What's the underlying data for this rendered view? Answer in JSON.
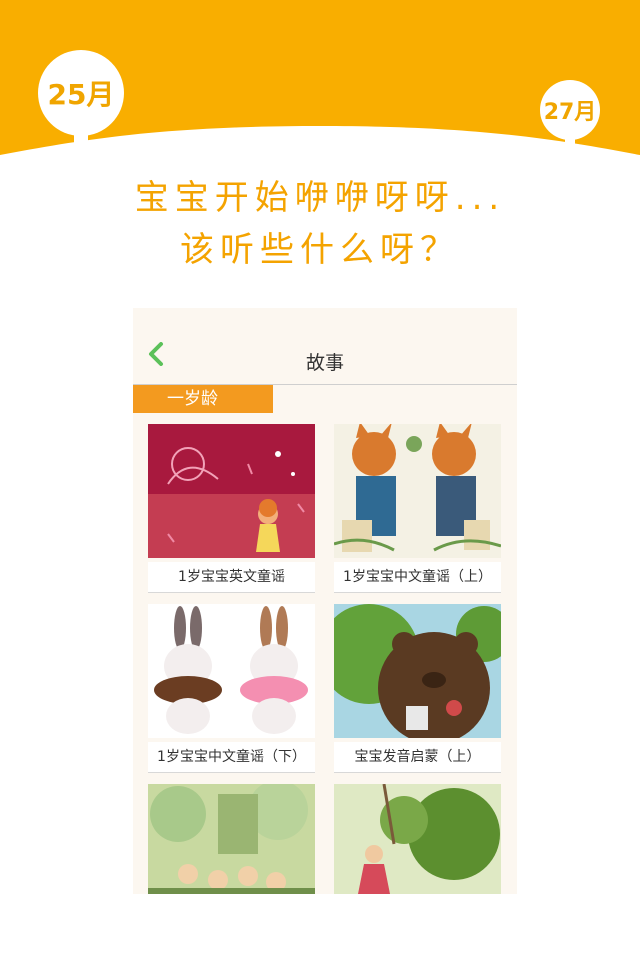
{
  "banner": {
    "color": "#f9ae00",
    "left_month": "25月",
    "right_month": "27月"
  },
  "headline": {
    "line1": "宝宝开始咿咿呀呀...",
    "line2": "该听些什么呀？",
    "color": "#f4a300"
  },
  "app": {
    "nav": {
      "title": "故事",
      "back_icon": "chevron-left-icon",
      "back_color": "#5cc15a"
    },
    "age_tab": {
      "label": "一岁龄",
      "color": "#f39a1f"
    },
    "cards": [
      {
        "title": "1岁宝宝英文童谣",
        "image": "girl-illustration"
      },
      {
        "title": "1岁宝宝中文童谣（上）",
        "image": "foxes-illustration"
      },
      {
        "title": "1岁宝宝中文童谣（下）",
        "image": "rabbits-donuts-illustration"
      },
      {
        "title": "宝宝发音启蒙（上）",
        "image": "bear-illustration"
      },
      {
        "title": "",
        "image": "forest-children-illustration"
      },
      {
        "title": "",
        "image": "girl-tree-illustration"
      }
    ]
  }
}
